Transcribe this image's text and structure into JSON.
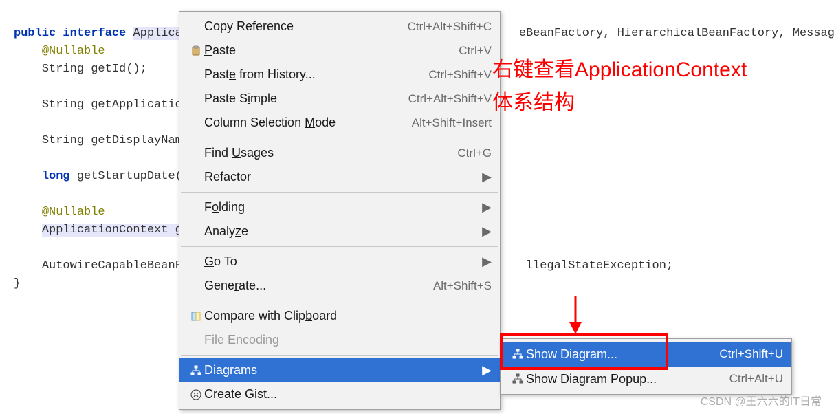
{
  "code": {
    "kw_public": "public",
    "kw_interface": "interface",
    "type_applica": "Applica",
    "extends_tail": "eBeanFactory, HierarchicalBeanFactory, MessageSou",
    "nullable1": "@Nullable",
    "line_getId": "String getId();",
    "line_getApplicatio": "String getApplicatio",
    "line_getDisplayNam": "String getDisplayNam",
    "kw_long": "long",
    "line_getStartupDate": " getStartupDate(",
    "nullable2": "@Nullable",
    "line_appctx_g": "ApplicationContext g",
    "line_autowire": "AutowireCapableBeanF",
    "line_illegal_tail": "llegalStateException;",
    "brace_close": "}"
  },
  "menu": {
    "copy_reference": "Copy Reference",
    "copy_reference_sc": "Ctrl+Alt+Shift+C",
    "paste": "Paste",
    "paste_sc": "Ctrl+V",
    "paste_history": "Paste from History...",
    "paste_history_sc": "Ctrl+Shift+V",
    "paste_simple": "Paste Simple",
    "paste_simple_sc": "Ctrl+Alt+Shift+V",
    "column_mode": "Column Selection Mode",
    "column_mode_sc": "Alt+Shift+Insert",
    "find_usages": "Find Usages",
    "find_usages_sc": "Ctrl+G",
    "refactor": "Refactor",
    "folding": "Folding",
    "analyze": "Analyze",
    "goto": "Go To",
    "generate": "Generate...",
    "generate_sc": "Alt+Shift+S",
    "compare_clipboard": "Compare with Clipboard",
    "file_encoding": "File Encoding",
    "diagrams": "Diagrams",
    "create_gist": "Create Gist..."
  },
  "submenu": {
    "show_diagram": "Show Diagram...",
    "show_diagram_sc": "Ctrl+Shift+U",
    "show_diagram_popup": "Show Diagram Popup...",
    "show_diagram_popup_sc": "Ctrl+Alt+U"
  },
  "annotation": {
    "line1": "右键查看ApplicationContext",
    "line2": "体系结构"
  },
  "watermark": "CSDN @王六六的IT日常"
}
